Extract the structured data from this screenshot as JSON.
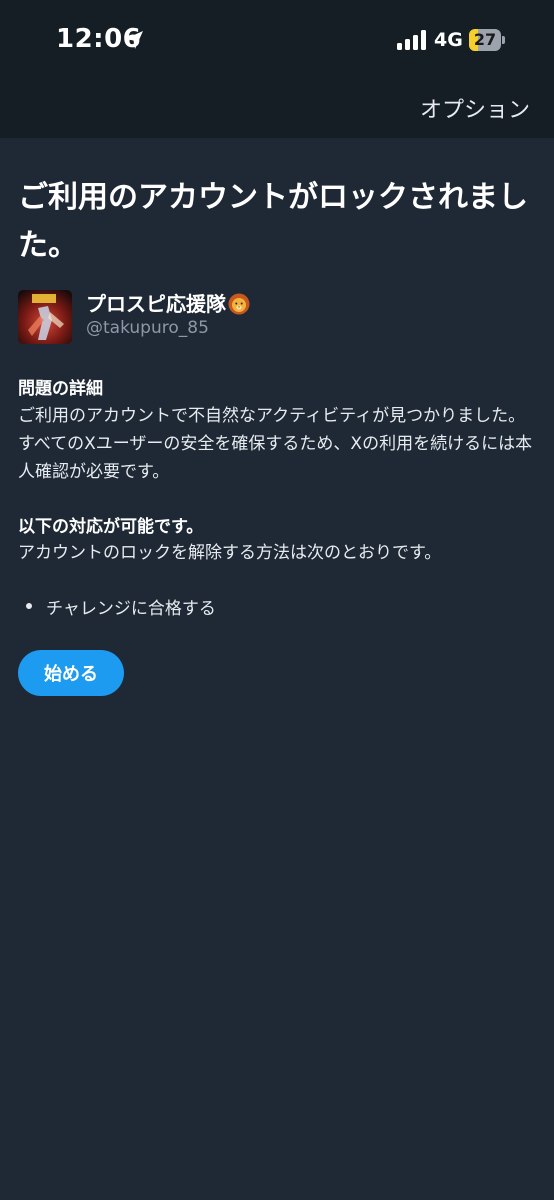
{
  "status_bar": {
    "time": "12:06",
    "network": "4G",
    "battery": "27",
    "battery_level": 0.27,
    "battery_color": "#f7cf2b"
  },
  "nav": {
    "options_label": "オプション"
  },
  "page": {
    "title": "ご利用のアカウントがロックされました。"
  },
  "account": {
    "display_name": "プロスピ応援隊",
    "username": "@takupuro_85",
    "name_emoji_icon": "lion-face-icon"
  },
  "problem": {
    "heading": "問題の詳細",
    "body": "ご利用のアカウントで不自然なアクティビティが見つかりました。すべてのXユーザーの安全を確保するため、Xの利用を続けるには本人確認が必要です。"
  },
  "actions": {
    "heading": "以下の対応が可能です。",
    "body": "アカウントのロックを解除する方法は次のとおりです。",
    "items": [
      "チャレンジに合格する"
    ]
  },
  "start_button": {
    "label": "始める",
    "color": "#1d9bf0"
  }
}
